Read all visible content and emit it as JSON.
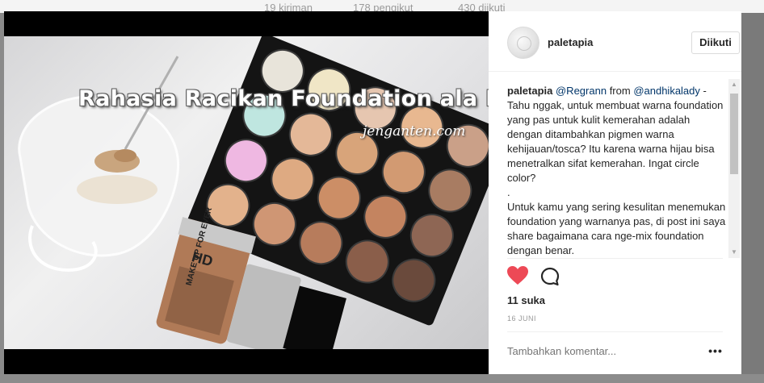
{
  "background_profile": {
    "stats": [
      "19 kiriman",
      "178 pengikut",
      "430 diikuti"
    ]
  },
  "post": {
    "image": {
      "overlay_title": "Rahasia Racikan Foundation ala MUA",
      "watermark": "jenganten.com",
      "product_text": "MAKE UP FOR EVER",
      "product_hd": "HD"
    },
    "header": {
      "username": "paletapia",
      "follow_label": "Diikuti"
    },
    "caption": {
      "username": "paletapia",
      "mention_1": "@Regrann",
      "from_text": "from",
      "mention_2": "@andhikalady",
      "dash": "-",
      "body_1": "Tahu nggak, untuk membuat warna foundation yang pas untuk kulit kemerahan adalah dengan ditambahkan pigmen warna kehijauan/tosca? Itu karena warna hijau bisa menetralkan sifat kemerahan. Ingat circle color?",
      "dot": ".",
      "body_2": "Untuk kamu yang sering kesulitan menemukan foundation yang warnanya pas, di post ini saya share bagaimana cara nge-mix foundation dengan benar."
    },
    "actions": {
      "heart_icon": "heart-icon",
      "comment_icon": "comment-icon",
      "liked": true,
      "heart_color": "#ed4956"
    },
    "likes": "11 suka",
    "date": "16 JUNI",
    "comment_placeholder": "Tambahkan komentar...",
    "more_label": "•••"
  }
}
